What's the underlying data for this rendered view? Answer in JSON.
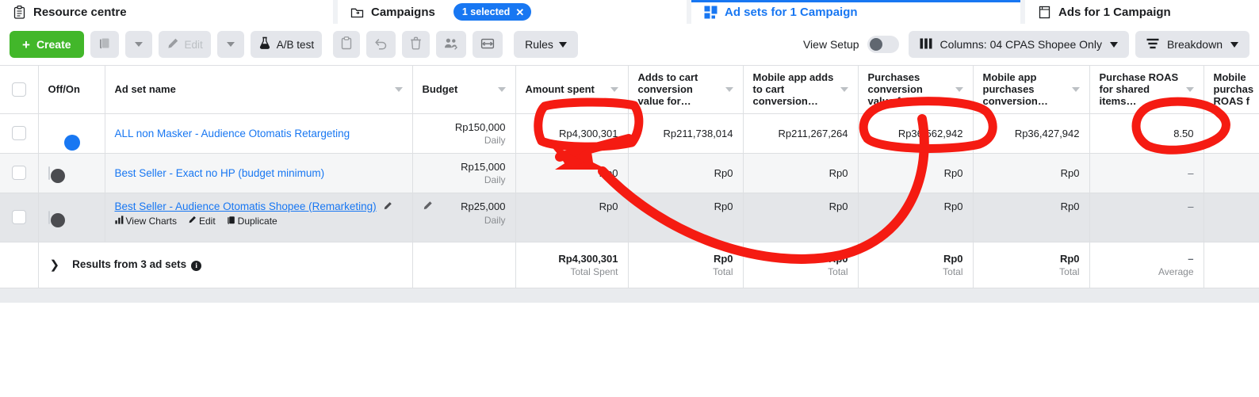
{
  "tabs": [
    {
      "label": "Resource centre",
      "icon": "clipboard-icon",
      "active": false,
      "badge": null
    },
    {
      "label": "Campaigns",
      "icon": "folder-icon",
      "active": false,
      "badge": "1 selected"
    },
    {
      "label": "Ad sets for 1 Campaign",
      "icon": "grid-squares-icon",
      "active": true,
      "badge": null
    },
    {
      "label": "Ads for 1 Campaign",
      "icon": "page-icon",
      "active": false,
      "badge": null
    }
  ],
  "toolbar": {
    "create_label": "Create",
    "duplicate_icon": "duplicate-icon",
    "duplicate_caret_icon": "chevron-down-icon",
    "edit_label": "Edit",
    "edit_icon": "pencil-icon",
    "edit_caret_icon": "chevron-down-icon",
    "abtest_label": "A/B test",
    "abtest_icon": "flask-icon",
    "paste_icon": "clipboard-icon",
    "revert_icon": "undo-icon",
    "delete_icon": "trash-icon",
    "audience_icon": "people-icon",
    "export_icon": "share-icon",
    "rules_label": "Rules",
    "rules_caret_icon": "chevron-down-icon",
    "view_setup_label": "View Setup",
    "view_setup_toggle_icon": "toggle-off-icon",
    "columns_label": "Columns: 04 CPAS Shopee Only",
    "columns_icon": "columns-icon",
    "columns_caret_icon": "chevron-down-icon",
    "breakdown_label": "Breakdown",
    "breakdown_icon": "breakdown-icon",
    "breakdown_caret_icon": "chevron-down-icon"
  },
  "table": {
    "headers": [
      {
        "label": "",
        "sortable": false
      },
      {
        "label": "Off/On",
        "sortable": false
      },
      {
        "label": "Ad set name",
        "sortable": true
      },
      {
        "label": "Budget",
        "sortable": true
      },
      {
        "label": "Amount spent",
        "sortable": true
      },
      {
        "label": "Adds to cart conversion value for…",
        "sortable": true
      },
      {
        "label": "Mobile app adds to cart conversion…",
        "sortable": true
      },
      {
        "label": "Purchases conversion value for…",
        "sortable": true
      },
      {
        "label": "Mobile app purchases conversion…",
        "sortable": true
      },
      {
        "label": "Purchase ROAS for shared items…",
        "sortable": true
      },
      {
        "label": "Mobile purchas ROAS f",
        "sortable": true
      }
    ],
    "rows": [
      {
        "selected": false,
        "toggle": "on",
        "name": "ALL non Masker - Audience Otomatis Retargeting",
        "underlined": false,
        "show_actions": false,
        "show_budget_pencil": false,
        "budget": "Rp150,000",
        "budget_sub": "Daily",
        "amount_spent": "Rp4,300,301",
        "adds_to_cart_value": "Rp211,738,014",
        "mobile_app_adds_to_cart": "Rp211,267,264",
        "purchases_conv_value": "Rp36,562,942",
        "mobile_app_purchases": "Rp36,427,942",
        "purchase_roas": "8.50",
        "mobile_roas": ""
      },
      {
        "selected": false,
        "toggle": "off",
        "name": "Best Seller - Exact no HP (budget minimum)",
        "underlined": false,
        "show_actions": false,
        "show_budget_pencil": false,
        "budget": "Rp15,000",
        "budget_sub": "Daily",
        "amount_spent": "Rp0",
        "adds_to_cart_value": "Rp0",
        "mobile_app_adds_to_cart": "Rp0",
        "purchases_conv_value": "Rp0",
        "mobile_app_purchases": "Rp0",
        "purchase_roas": "–",
        "mobile_roas": ""
      },
      {
        "selected": false,
        "toggle": "off",
        "name": "Best Seller - Audience Otomatis Shopee (Remarketing)",
        "underlined": true,
        "show_actions": true,
        "show_budget_pencil": true,
        "budget": "Rp25,000",
        "budget_sub": "Daily",
        "amount_spent": "Rp0",
        "adds_to_cart_value": "Rp0",
        "mobile_app_adds_to_cart": "Rp0",
        "purchases_conv_value": "Rp0",
        "mobile_app_purchases": "Rp0",
        "purchase_roas": "–",
        "mobile_roas": ""
      }
    ],
    "row_actions": {
      "view_charts": "View Charts",
      "edit": "Edit",
      "duplicate": "Duplicate",
      "view_charts_icon": "bar-chart-icon",
      "edit_icon": "pencil-icon",
      "duplicate_icon": "duplicate-icon",
      "name_edit_icon": "pencil-icon",
      "budget_edit_icon": "pencil-icon"
    },
    "totals": {
      "expand_icon": "chevron-right-icon",
      "label": "Results from 3 ad sets",
      "info_icon": "info-icon",
      "budget": "",
      "budget_sub": "",
      "amount_spent": "Rp4,300,301",
      "amount_spent_sub": "Total Spent",
      "adds_to_cart_value": "Rp0",
      "adds_to_cart_value_sub": "Total",
      "mobile_app_adds_to_cart": "Rp0",
      "mobile_app_adds_to_cart_sub": "Total",
      "purchases_conv_value": "Rp0",
      "purchases_conv_value_sub": "Total",
      "mobile_app_purchases": "Rp0",
      "mobile_app_purchases_sub": "Total",
      "purchase_roas": "–",
      "purchase_roas_sub": "Average",
      "mobile_roas": "",
      "mobile_roas_sub": ""
    }
  },
  "annotations": {
    "color": "#f51b12",
    "marks": [
      "arrow-pointing-to-amount-spent",
      "circle-around-purchases-conversion-value",
      "circle-around-purchase-roas"
    ]
  },
  "colors": {
    "accent_blue": "#1877f2",
    "create_green": "#42b72a",
    "annotation_red": "#f51b12",
    "chrome_gray": "#e4e6eb",
    "border_gray": "#dddfe2"
  }
}
